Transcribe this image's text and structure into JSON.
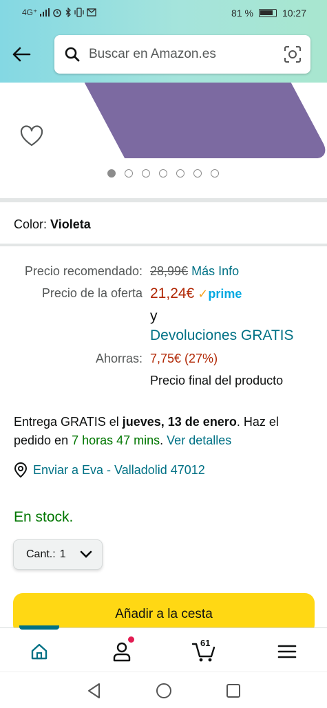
{
  "status_bar": {
    "network": "4G⁺",
    "battery": "81 %",
    "time": "10:27"
  },
  "search": {
    "placeholder": "Buscar en Amazon.es"
  },
  "gallery": {
    "image_count": 7,
    "active_index": 0
  },
  "color": {
    "label": "Color:",
    "value": "Violeta"
  },
  "price": {
    "recommended_label": "Precio recomendado:",
    "recommended_value": "28,99€",
    "more_info": "Más Info",
    "deal_label": "Precio de la oferta",
    "deal_value": "21,24€",
    "prime_label": "prime",
    "and_text": "y",
    "returns_text": "Devoluciones GRATIS",
    "savings_label": "Ahorras:",
    "savings_value": "7,75€ (27%)",
    "final_note": "Precio final del producto"
  },
  "delivery": {
    "prefix": "Entrega GRATIS el ",
    "date": "jueves, 13 de enero",
    "suffix": ". Haz el pedido en ",
    "countdown": "7 horas 47 mins",
    "details_link": "Ver detalles"
  },
  "location": {
    "text": "Enviar a Eva - Valladolid 47012"
  },
  "stock": {
    "text": "En stock."
  },
  "quantity": {
    "label": "Cant.:",
    "value": "1"
  },
  "add_to_cart": {
    "label": "Añadir a la cesta"
  },
  "bottom_nav": {
    "cart_count": "61"
  },
  "colors": {
    "accent": "#007185",
    "deal": "#b12704",
    "stock": "#007600",
    "cart_button": "#ffd814"
  }
}
